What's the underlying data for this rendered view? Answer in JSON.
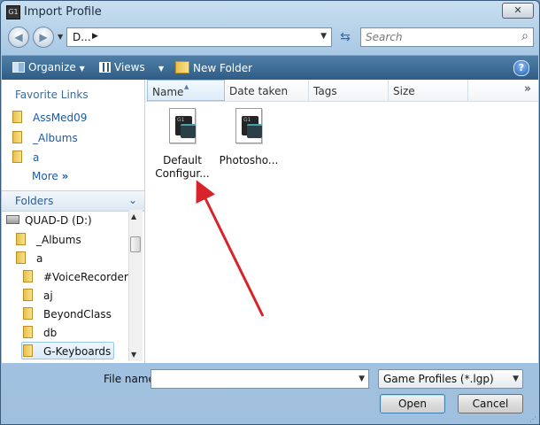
{
  "window": {
    "title": "Import Profile",
    "icon": "logitech-g-icon",
    "close_glyph": "✕"
  },
  "navbar": {
    "back_glyph": "◀",
    "forward_glyph": "▶",
    "dropdown_glyph": "▼",
    "address_text": "D...",
    "address_sep": "▶",
    "address_dd": "▼",
    "refresh_glyph": "⇆",
    "search_placeholder": "Search",
    "search_glyph": "⌕"
  },
  "toolbar": {
    "organize": "Organize",
    "views": "Views",
    "new_folder": "New Folder",
    "dd": "▼",
    "help": "?"
  },
  "favorites": {
    "header": "Favorite Links",
    "items": [
      "AssMed09",
      "_Albums",
      "a"
    ],
    "more": "More",
    "more_glyph": "»"
  },
  "folders": {
    "label": "Folders",
    "chevron": "⌄",
    "tree": [
      {
        "label": "QUAD-D (D:)",
        "kind": "drive"
      },
      {
        "label": "_Albums",
        "kind": "folder"
      },
      {
        "label": "a",
        "kind": "folder"
      },
      {
        "label": "#VoiceRecorder",
        "kind": "folder"
      },
      {
        "label": "aj",
        "kind": "folder"
      },
      {
        "label": "BeyondClass",
        "kind": "folder"
      },
      {
        "label": "db",
        "kind": "folder"
      },
      {
        "label": "G-Keyboards",
        "kind": "folder",
        "selected": true
      }
    ],
    "scroll_up": "▲",
    "scroll_down": "▼"
  },
  "columns": {
    "name": "Name",
    "date": "Date taken",
    "tags": "Tags",
    "size": "Size",
    "more": "»",
    "sort": "▲"
  },
  "files": [
    {
      "line1": "Default",
      "line2": "Configur...",
      "icon": "lgp-profile-icon",
      "g1": "G1"
    },
    {
      "line1": "Photosho...",
      "line2": "",
      "icon": "lgp-profile-icon",
      "g1": "G1"
    }
  ],
  "footer": {
    "file_name_label": "File name:",
    "file_name_value": "",
    "file_type": "Game Profiles (*.lgp)",
    "dd": "▼",
    "open": "Open",
    "cancel": "Cancel",
    "grip": "⋰"
  },
  "annotation": {
    "color": "#d9232a"
  }
}
